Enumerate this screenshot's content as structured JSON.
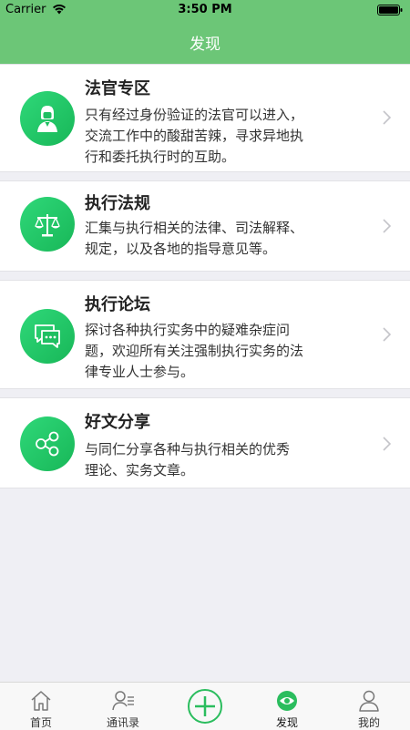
{
  "status_bar": {
    "carrier": "Carrier",
    "time": "3:50 PM"
  },
  "header": {
    "title": "发现"
  },
  "accent_color": "#6cc677",
  "cards": [
    {
      "icon": "judge-icon",
      "title": "法官专区",
      "description": [
        "只有经过身份验证的法官可以进入，",
        "交流工作中的酸甜苦辣，寻求异地执",
        "行和委托执行时的互助。"
      ]
    },
    {
      "icon": "scales-icon",
      "title": "执行法规",
      "description": [
        "汇集与执行相关的法律、司法解释、",
        "规定，以及各地的指导意见等。"
      ]
    },
    {
      "icon": "chat-bubbles-icon",
      "title": "执行论坛",
      "description": [
        "探讨各种执行实务中的疑难杂症问",
        "题，欢迎所有关注强制执行实务的法",
        "律专业人士参与。"
      ]
    },
    {
      "icon": "share-icon",
      "title": "好文分享",
      "description": [
        "与同仁分享各种与执行相关的优秀",
        "理论、实务文章。"
      ]
    }
  ],
  "tabbar": {
    "items": [
      {
        "icon": "home-icon",
        "label": "首页"
      },
      {
        "icon": "contacts-icon",
        "label": "通讯录"
      },
      {
        "icon": "plus-circle-icon",
        "label": ""
      },
      {
        "icon": "eye-icon",
        "label": "发现",
        "active": true
      },
      {
        "icon": "person-icon",
        "label": "我的"
      }
    ]
  }
}
